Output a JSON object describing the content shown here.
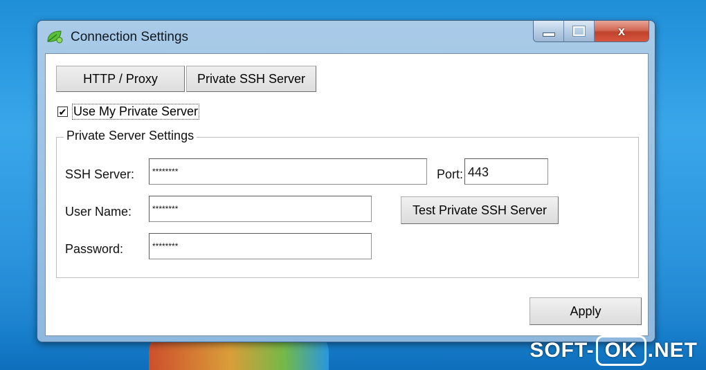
{
  "window": {
    "title": "Connection Settings",
    "close_glyph": "x",
    "icon": "app-leaf-icon"
  },
  "tabs": [
    {
      "label": "HTTP / Proxy"
    },
    {
      "label": "Private SSH Server"
    }
  ],
  "use_private_server": {
    "label": "Use My Private Server",
    "checked": true,
    "check_glyph": "✔"
  },
  "group": {
    "title": "Private Server Settings",
    "ssh_server_label": "SSH Server:",
    "ssh_server_value": "********",
    "port_label": "Port:",
    "port_value": "443",
    "user_name_label": "User Name:",
    "user_name_value": "********",
    "password_label": "Password:",
    "password_value": "********",
    "test_button": "Test Private SSH Server"
  },
  "apply_button": "Apply",
  "watermark": {
    "left": "SOFT-",
    "box": "OK",
    "right": ".NET"
  },
  "colors": {
    "desktop": "#2a93dc",
    "titlebar": "#a9cbe8",
    "close_button": "#c0432b"
  }
}
